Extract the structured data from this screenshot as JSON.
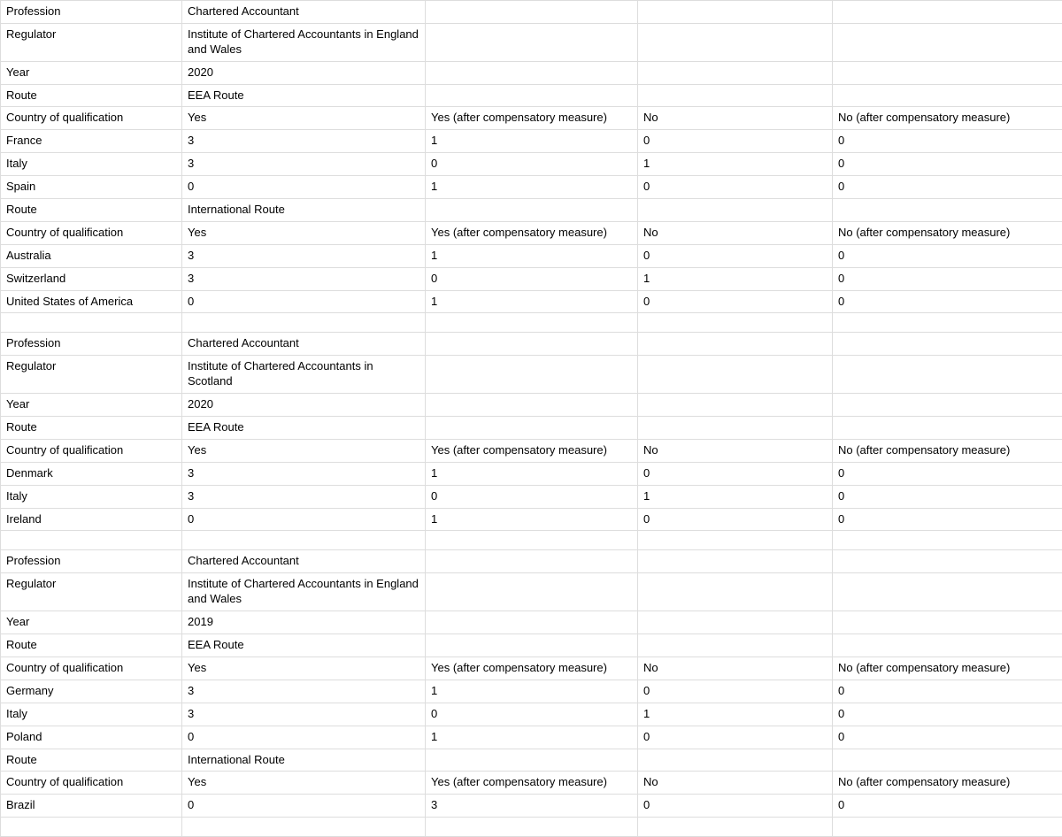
{
  "labels": {
    "profession": "Profession",
    "regulator": "Regulator",
    "year": "Year",
    "route": "Route",
    "coq": "Country of qualification",
    "yes": "Yes",
    "yesComp": "Yes (after compensatory measure)",
    "no": "No",
    "noComp": "No (after compensatory measure)"
  },
  "blocks": [
    {
      "profession": "Chartered Accountant",
      "regulator": "Institute of Chartered Accountants in England and Wales",
      "year": "2020",
      "routes": [
        {
          "name": "EEA Route",
          "rows": [
            {
              "country": "France",
              "yes": "3",
              "yesComp": "1",
              "no": "0",
              "noComp": "0"
            },
            {
              "country": "Italy",
              "yes": "3",
              "yesComp": "0",
              "no": "1",
              "noComp": "0"
            },
            {
              "country": "Spain",
              "yes": "0",
              "yesComp": "1",
              "no": "0",
              "noComp": "0"
            }
          ]
        },
        {
          "name": "International Route",
          "rows": [
            {
              "country": "Australia",
              "yes": "3",
              "yesComp": "1",
              "no": "0",
              "noComp": "0"
            },
            {
              "country": "Switzerland",
              "yes": "3",
              "yesComp": "0",
              "no": "1",
              "noComp": "0"
            },
            {
              "country": "United States of America",
              "yes": "0",
              "yesComp": "1",
              "no": "0",
              "noComp": "0"
            }
          ]
        }
      ],
      "trailingBlank": true
    },
    {
      "profession": "Chartered Accountant",
      "regulator": "Institute of Chartered Accountants in Scotland",
      "year": "2020",
      "routes": [
        {
          "name": "EEA Route",
          "rows": [
            {
              "country": "Denmark",
              "yes": "3",
              "yesComp": "1",
              "no": "0",
              "noComp": "0"
            },
            {
              "country": "Italy",
              "yes": "3",
              "yesComp": "0",
              "no": "1",
              "noComp": "0"
            },
            {
              "country": "Ireland",
              "yes": "0",
              "yesComp": "1",
              "no": "0",
              "noComp": "0"
            }
          ]
        }
      ],
      "trailingBlank": true
    },
    {
      "profession": "Chartered Accountant",
      "regulator": "Institute of Chartered Accountants in England and Wales",
      "year": "2019",
      "routes": [
        {
          "name": "EEA Route",
          "rows": [
            {
              "country": "Germany",
              "yes": "3",
              "yesComp": "1",
              "no": "0",
              "noComp": "0"
            },
            {
              "country": "Italy",
              "yes": "3",
              "yesComp": "0",
              "no": "1",
              "noComp": "0"
            },
            {
              "country": "Poland",
              "yes": "0",
              "yesComp": "1",
              "no": "0",
              "noComp": "0"
            }
          ]
        },
        {
          "name": "International Route",
          "rows": [
            {
              "country": "Brazil",
              "yes": "0",
              "yesComp": "3",
              "no": "0",
              "noComp": "0"
            }
          ]
        }
      ],
      "trailingBlank": true
    }
  ]
}
